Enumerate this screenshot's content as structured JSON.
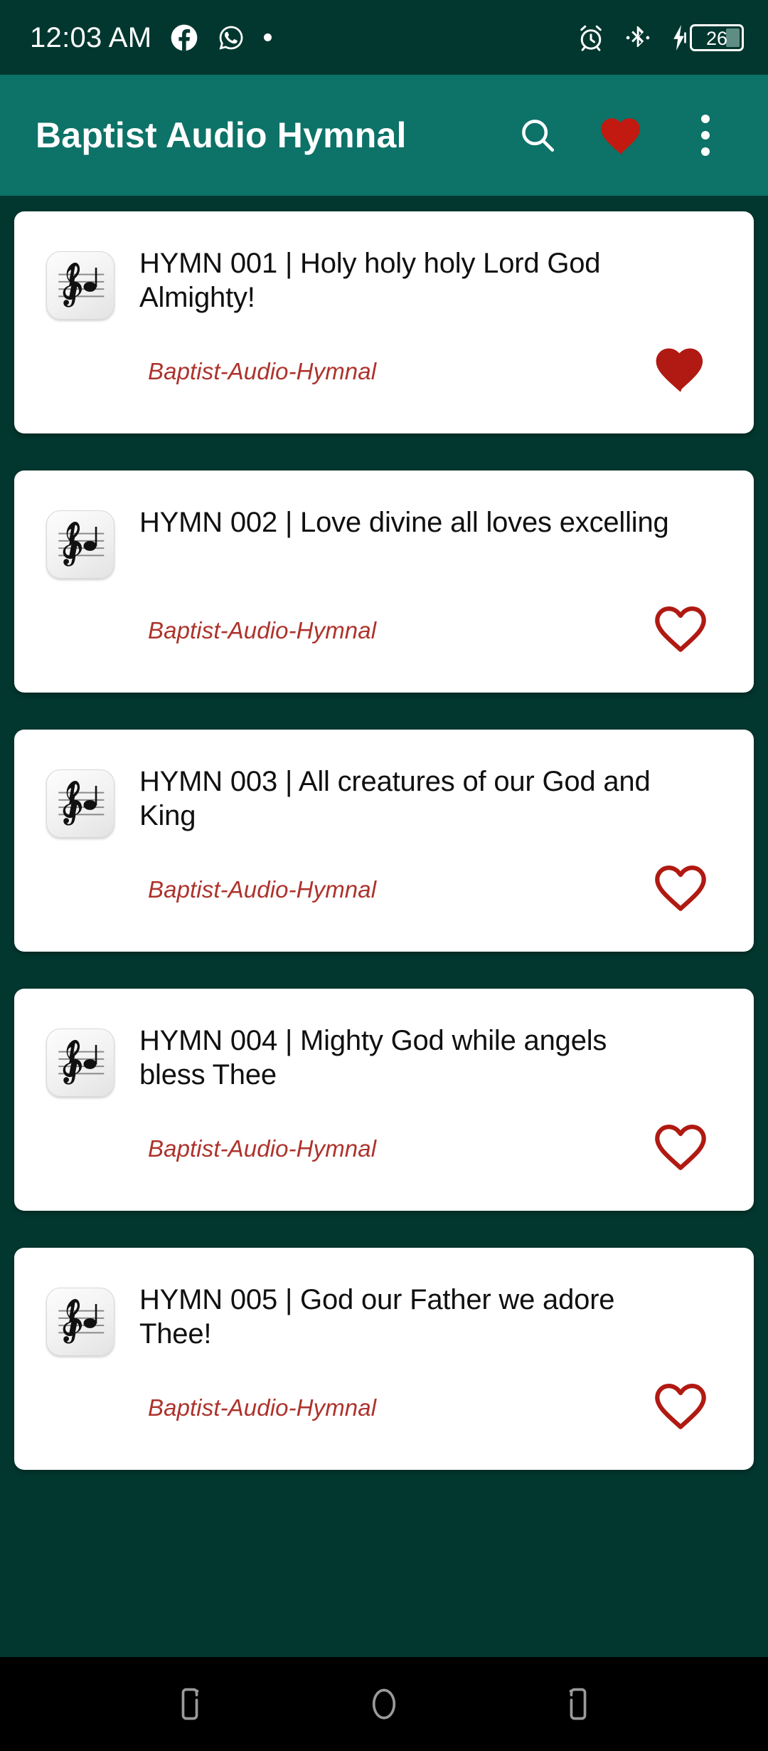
{
  "status_bar": {
    "time": "12:03 AM",
    "notification_icons": [
      "facebook-icon",
      "whatsapp-icon",
      "notification-dot"
    ],
    "system_icons": [
      "alarm-icon",
      "bluetooth-icon",
      "charging-bolt-icon"
    ],
    "battery_percent": "26"
  },
  "app_bar": {
    "title": "Baptist Audio Hymnal",
    "actions": [
      {
        "name": "search-icon",
        "label": "Search"
      },
      {
        "name": "favorites-heart-icon",
        "label": "Favorites"
      },
      {
        "name": "overflow-menu-icon",
        "label": "More options"
      }
    ]
  },
  "colors": {
    "status_bar_bg": "#02372f",
    "app_bar_bg": "#0d7268",
    "page_bg": "#02372f",
    "card_bg": "#ffffff",
    "accent_red": "#c21a10",
    "subtitle_red": "#ad332c",
    "title_text": "#101010",
    "nav_bar_bg": "#000000"
  },
  "list": {
    "items": [
      {
        "title": "HYMN 001 | Holy holy holy Lord God Almighty!",
        "subtitle": "Baptist-Audio-Hymnal",
        "thumbnail": "music-note-icon",
        "favorited": true
      },
      {
        "title": "HYMN 002 | Love divine all loves excelling",
        "subtitle": "Baptist-Audio-Hymnal",
        "thumbnail": "music-note-icon",
        "favorited": false
      },
      {
        "title": "HYMN 003 | All creatures of our God and King",
        "subtitle": "Baptist-Audio-Hymnal",
        "thumbnail": "music-note-icon",
        "favorited": false
      },
      {
        "title": "HYMN 004 | Mighty God while angels bless Thee",
        "subtitle": "Baptist-Audio-Hymnal",
        "thumbnail": "music-note-icon",
        "favorited": false
      },
      {
        "title": "HYMN 005 | God our Father we adore Thee!",
        "subtitle": "Baptist-Audio-Hymnal",
        "thumbnail": "music-note-icon",
        "favorited": false
      }
    ]
  },
  "nav_bar": {
    "buttons": [
      {
        "name": "recents-icon",
        "label": "Recents"
      },
      {
        "name": "home-icon",
        "label": "Home"
      },
      {
        "name": "back-icon",
        "label": "Back"
      }
    ]
  }
}
